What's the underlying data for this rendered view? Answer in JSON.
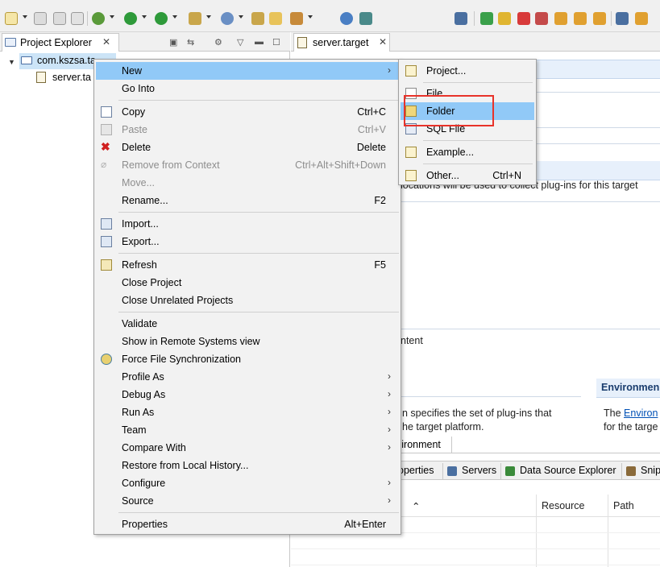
{
  "toolbar": {
    "icons": [
      "new-icon",
      "save-icon",
      "save-all-icon",
      "print-icon",
      "debug-icon",
      "run-icon",
      "run-config-icon",
      "new-java-project-icon",
      "new-server-icon",
      "open-type-icon",
      "open-folder-icon",
      "search-icon",
      "globe-icon",
      "connect-icon",
      "disconnect-icon",
      "resume-icon",
      "suspend-icon",
      "terminate-icon",
      "disconnect-debug-icon",
      "step-into-icon",
      "step-over-icon",
      "step-return-icon",
      "drop-to-frame-icon",
      "use-step-filters-icon"
    ]
  },
  "project_explorer": {
    "tab_label": "Project Explorer",
    "tree": {
      "project_label": "com.kszsa.ta",
      "file_label": "server.ta"
    }
  },
  "editor": {
    "tab_label": "server.target",
    "locations_text": "locations will be used to collect plug-ins for this target",
    "content_text": "ntent",
    "environment_title": "Environmen",
    "specifies_line1": "n specifies the set of plug-ins that",
    "specifies_line2": "he target platform.",
    "env_text_prefix": "The",
    "env_link": "Environ",
    "env_line2": "for the targe",
    "env_tab_label": "vironment"
  },
  "bottom_views": {
    "tabs": [
      {
        "label": "operties"
      },
      {
        "label": "Servers"
      },
      {
        "label": "Data Source Explorer"
      },
      {
        "label": "Snip"
      }
    ],
    "grid_headers": [
      "Resource",
      "Path"
    ]
  },
  "context_menu": {
    "items": [
      {
        "label": "New",
        "submenu": true,
        "highlight": true
      },
      {
        "label": "Go Into"
      },
      {
        "label": "Copy",
        "shortcut": "Ctrl+C",
        "icon": "copy-icon"
      },
      {
        "label": "Paste",
        "shortcut": "Ctrl+V",
        "icon": "paste-icon",
        "disabled": true
      },
      {
        "label": "Delete",
        "shortcut": "Delete",
        "icon": "delete-icon"
      },
      {
        "label": "Remove from Context",
        "shortcut": "Ctrl+Alt+Shift+Down",
        "icon": "remove-context-icon",
        "disabled": true
      },
      {
        "label": "Move...",
        "disabled": true
      },
      {
        "label": "Rename...",
        "shortcut": "F2"
      },
      {
        "label": "Import...",
        "icon": "import-icon"
      },
      {
        "label": "Export...",
        "icon": "export-icon"
      },
      {
        "label": "Refresh",
        "shortcut": "F5",
        "icon": "refresh-icon"
      },
      {
        "label": "Close Project"
      },
      {
        "label": "Close Unrelated Projects"
      },
      {
        "label": "Validate"
      },
      {
        "label": "Show in Remote Systems view"
      },
      {
        "label": "Force File Synchronization",
        "icon": "sync-icon"
      },
      {
        "label": "Profile As",
        "submenu": true
      },
      {
        "label": "Debug As",
        "submenu": true
      },
      {
        "label": "Run As",
        "submenu": true
      },
      {
        "label": "Team",
        "submenu": true
      },
      {
        "label": "Compare With",
        "submenu": true
      },
      {
        "label": "Restore from Local History..."
      },
      {
        "label": "Configure",
        "submenu": true
      },
      {
        "label": "Source",
        "submenu": true
      },
      {
        "label": "Properties",
        "shortcut": "Alt+Enter"
      }
    ]
  },
  "new_submenu": {
    "items": [
      {
        "label": "Project...",
        "icon": "new-project-icon"
      },
      {
        "label": "File",
        "icon": "new-file-icon"
      },
      {
        "label": "Folder",
        "icon": "new-folder-icon",
        "highlight": true
      },
      {
        "label": "SQL File",
        "icon": "sql-file-icon"
      },
      {
        "label": "Example...",
        "icon": "example-icon"
      },
      {
        "label": "Other...",
        "shortcut": "Ctrl+N",
        "icon": "other-icon"
      }
    ]
  },
  "colors": {
    "menu_highlight": "#91c9f7",
    "selection": "#cce4f7",
    "annotation_box": "#e8332a"
  }
}
